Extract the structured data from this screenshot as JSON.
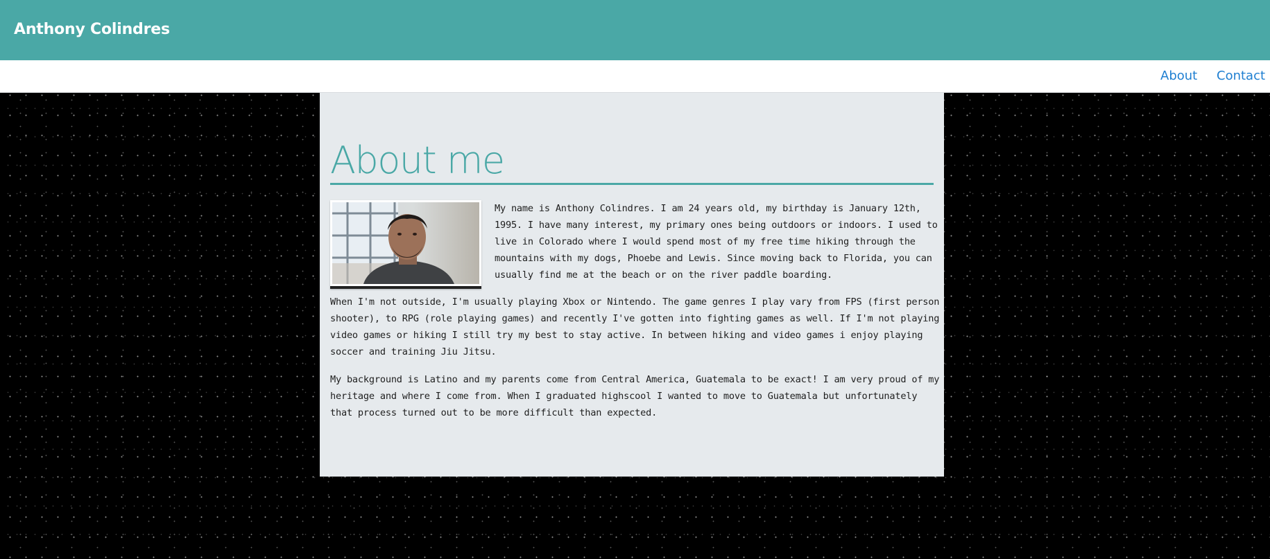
{
  "header": {
    "site_title": "Anthony Colindres",
    "background_color": "#4aa8a6"
  },
  "nav": {
    "items": [
      {
        "label": "About"
      },
      {
        "label": "Contact"
      }
    ],
    "link_color": "#1f7fd1"
  },
  "main": {
    "heading": "About me",
    "accent_color": "#4aa8a6",
    "panel_color": "#e6eaed",
    "photo_icon": "profile-photo",
    "paragraphs": [
      "My name is Anthony Colindres. I am 24 years old, my birthday is January 12th, 1995. I have many interest, my primary ones being outdoors or indoors. I used to live in Colorado where I would spend most of my free time hiking through the mountains with my dogs, Phoebe and Lewis. Since moving back to Florida, you can usually find me at the beach or on the river paddle boarding.",
      "When I'm not outside, I'm usually playing Xbox or Nintendo. The game genres I play vary from FPS (first person shooter), to RPG (role playing games) and recently I've gotten into fighting games as well. If I'm not playing video games or hiking I still try my best to stay active. In between hiking and video games i enjoy playing soccer and training Jiu Jitsu.",
      "My background is Latino and my parents come from Central America, Guatemala to be exact! I am very proud of my heritage and where I come from. When I graduated highscool I wanted to move to Guatemala but unfortunately that process turned out to be more difficult than expected."
    ]
  },
  "page_background": "#000000"
}
